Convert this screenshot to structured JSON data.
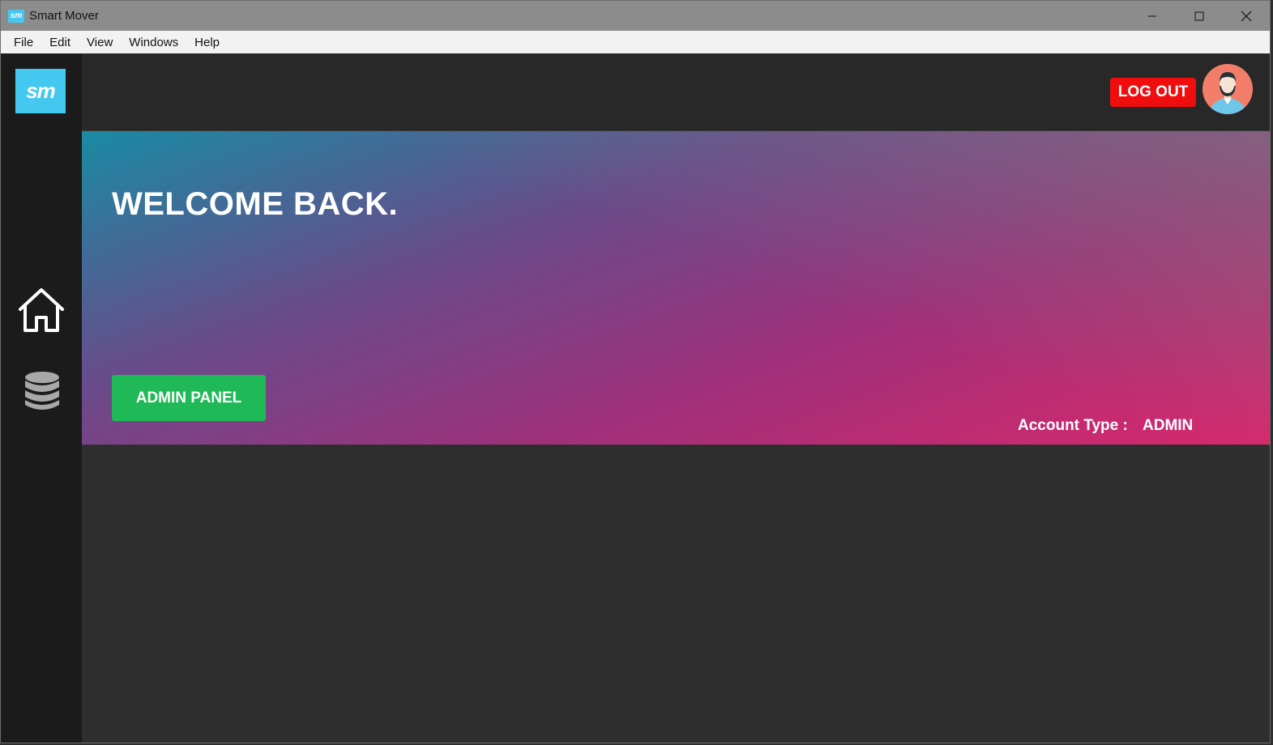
{
  "window": {
    "title": "Smart Mover",
    "app_icon_text": "sm",
    "controls": [
      "minimize-icon",
      "maximize-icon",
      "close-icon"
    ]
  },
  "menu": {
    "items": [
      "File",
      "Edit",
      "View",
      "Windows",
      "Help"
    ]
  },
  "sidebar": {
    "logo_text": "sm",
    "logo_color": "#45c8f0",
    "nav": [
      {
        "icon": "home-icon"
      },
      {
        "icon": "database-icon"
      }
    ]
  },
  "header": {
    "logout_label": "LOG OUT",
    "logout_color": "#f00d0d",
    "avatar_icon": "user-avatar-icon"
  },
  "hero": {
    "welcome": "WELCOME BACK.",
    "admin_button": "ADMIN PANEL",
    "admin_button_color": "#1fb957",
    "account_type_label": "Account Type :",
    "account_type_value": "ADMIN"
  }
}
